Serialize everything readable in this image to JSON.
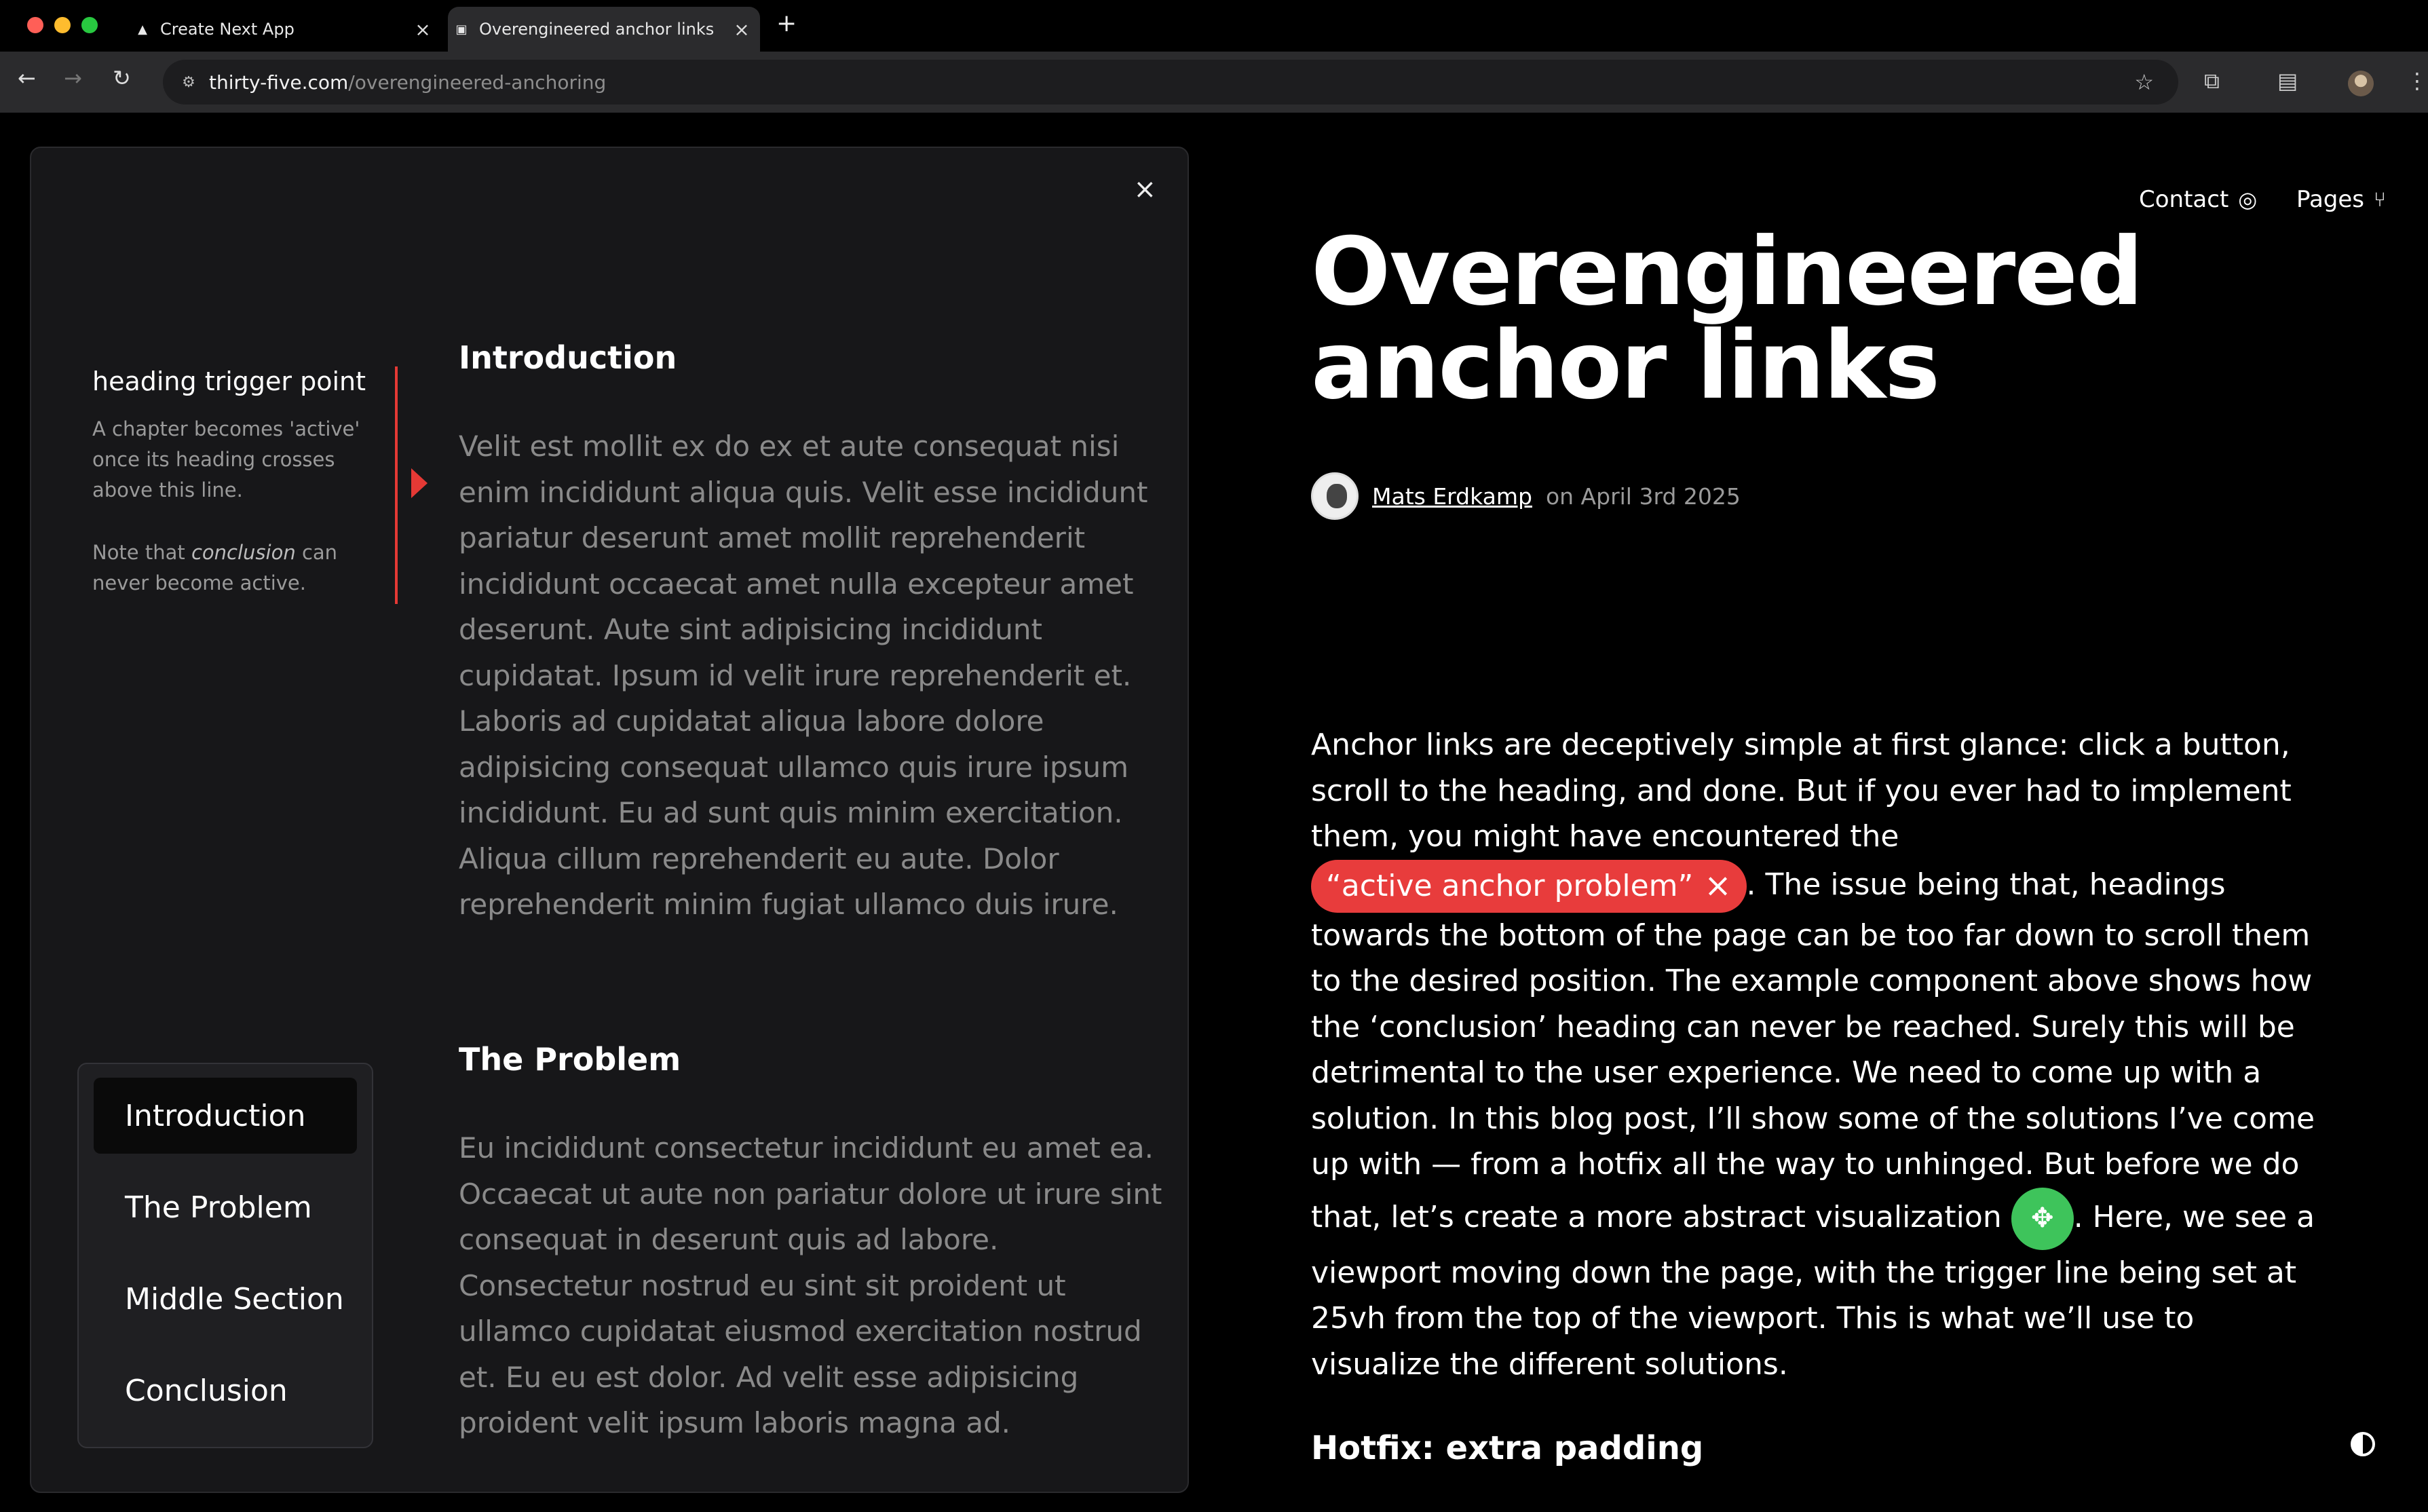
{
  "browser": {
    "tabs": [
      {
        "title": "Create Next App",
        "icon": "triangle-icon"
      },
      {
        "title": "Overengineered anchor links",
        "icon": "page-icon"
      }
    ],
    "url_host": "thirty-five.com",
    "url_path": "/overengineered-anchoring"
  },
  "demo": {
    "trigger_title": "heading trigger point",
    "trigger_desc": "A chapter becomes 'active' once its heading crosses above this line.",
    "note_before": "Note that ",
    "note_em": "conclusion",
    "note_after": " can never become active.",
    "sections": [
      {
        "heading": "Introduction",
        "body": "Velit est mollit ex do ex et aute consequat nisi enim incididunt aliqua quis. Velit esse incididunt pariatur deserunt amet mollit reprehenderit incididunt occaecat amet nulla excepteur amet deserunt. Aute sint adipisicing incididunt cupidatat. Ipsum id velit irure reprehenderit et. Laboris ad cupidatat aliqua labore dolore adipisicing consequat ullamco quis irure ipsum incididunt. Eu ad sunt quis minim exercitation. Aliqua cillum reprehenderit eu aute. Dolor reprehenderit minim fugiat ullamco duis irure."
      },
      {
        "heading": "The Problem",
        "body": "Eu incididunt consectetur incididunt eu amet ea. Occaecat ut aute non pariatur dolore ut irure sint consequat in deserunt quis ad labore. Consectetur nostrud eu sint sit proident ut ullamco cupidatat eiusmod exercitation nostrud et. Eu eu est dolor. Ad velit esse adipisicing proident velit ipsum laboris magna ad."
      }
    ],
    "toc": [
      "Introduction",
      "The Problem",
      "Middle Section",
      "Conclusion"
    ],
    "toc_active_index": 0
  },
  "nav": {
    "contact": "Contact",
    "pages": "Pages"
  },
  "article": {
    "title": "Overengineered anchor links",
    "author": "Mats Erdkamp",
    "date_text": "on April 3rd 2025",
    "p_1": "Anchor links are deceptively simple at first glance: click a button, scroll to the heading, and done. But if you ever had to implement them, you might have encountered the ",
    "chip": "“active anchor problem”",
    "p_2": ". The issue being that, headings towards the bottom of the page can be too far down to scroll them to the desired position. The example component above shows how the ‘conclusion’ heading can never be reached. Surely this will be detrimental to the user experience. We need to come up with a solution. In this blog post, I’ll show some of the solutions I’ve come up with — from a hotfix all the way to unhinged. But before we do that, let’s create a more abstract visualization ",
    "p_3": ". Here, we see a viewport moving down the page, with the trigger line being set at 25vh from the top of the viewport. This is what we’ll use to visualize the different solutions.",
    "h2": "Hotfix: extra padding"
  },
  "colors": {
    "accent_red": "#e83c3c",
    "accent_green": "#3ec45b"
  }
}
